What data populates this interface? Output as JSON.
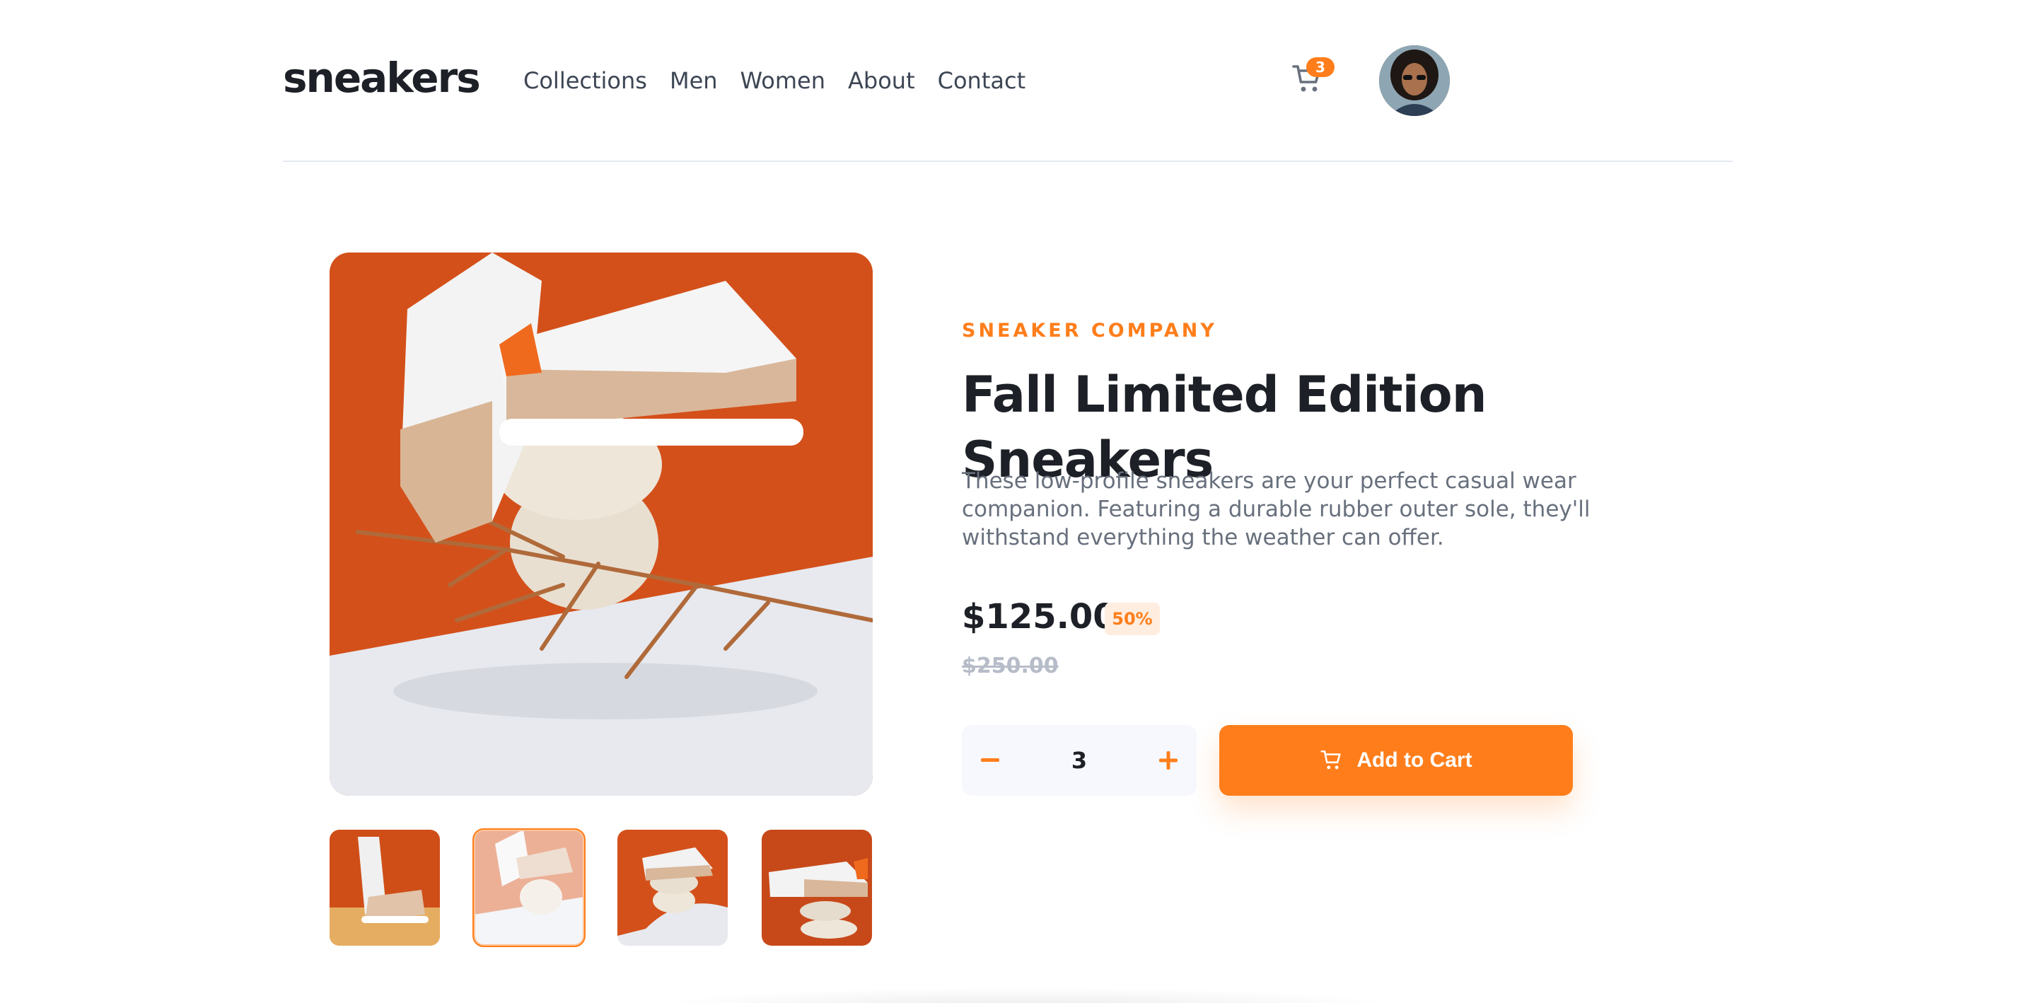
{
  "header": {
    "logo": "sneakers",
    "nav": [
      "Collections",
      "Men",
      "Women",
      "About",
      "Contact"
    ],
    "cart_count": "3"
  },
  "product": {
    "company": "SNEAKER COMPANY",
    "title": "Fall Limited Edition Sneakers",
    "description": "These low-profile sneakers are your perfect casual wear companion. Featuring a durable rubber outer sole, they'll withstand everything the weather can offer.",
    "price": "$125.00",
    "discount": "50%",
    "old_price": "$250.00",
    "quantity": "3",
    "add_to_cart_label": "Add to Cart"
  },
  "colors": {
    "accent": "#ff7e1b",
    "dark": "#1d2026",
    "muted": "#68707d"
  },
  "icons": [
    "cart-icon",
    "minus-icon",
    "plus-icon"
  ]
}
